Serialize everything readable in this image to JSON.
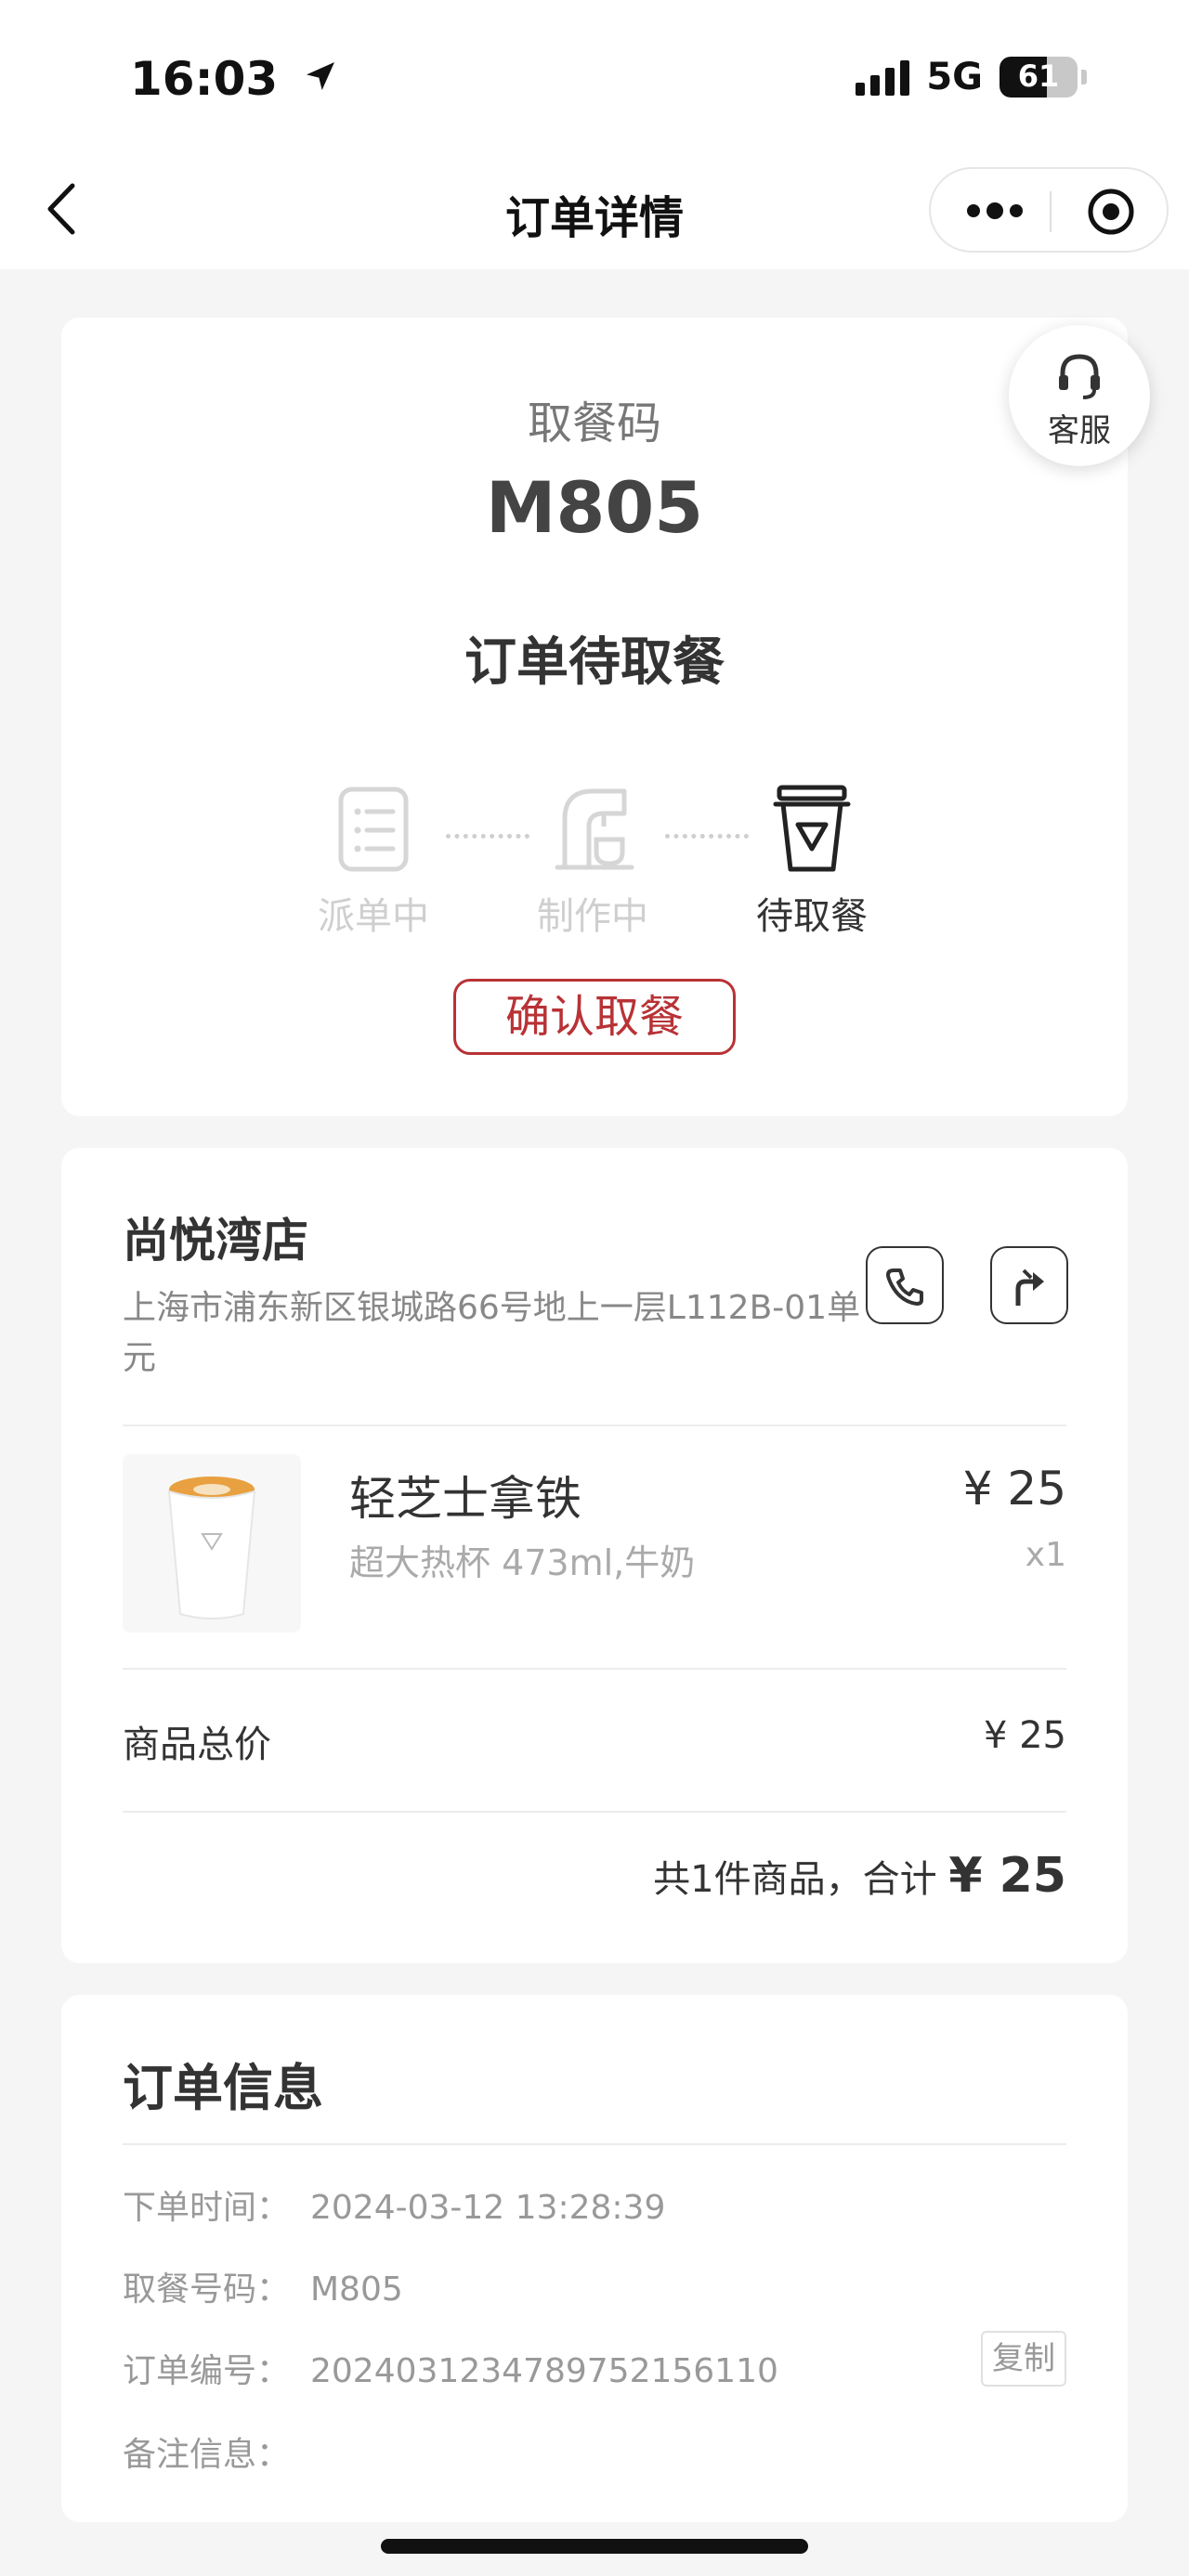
{
  "status_bar": {
    "time": "16:03",
    "network": "5G",
    "battery": "61",
    "battery_level": 0.61
  },
  "nav": {
    "title": "订单详情"
  },
  "pickup": {
    "label": "取餐码",
    "code": "M805",
    "status": "订单待取餐",
    "steps": [
      "派单中",
      "制作中",
      "待取餐"
    ],
    "active_step_index": 2,
    "confirm_label": "确认取餐"
  },
  "customer_service": {
    "label": "客服"
  },
  "store": {
    "name": "尚悦湾店",
    "address": "上海市浦东新区银城路66号地上一层L112B-01单元"
  },
  "product": {
    "name": "轻芝士拿铁",
    "spec": "超大热杯 473ml,牛奶",
    "price": "¥ 25",
    "qty": "x1"
  },
  "summary": {
    "subtotal_label": "商品总价",
    "subtotal_value": "¥ 25",
    "total_prefix": "共1件商品，合计",
    "total_value": "¥ 25"
  },
  "order_info": {
    "title": "订单信息",
    "rows": [
      {
        "key": "下单时间：",
        "value": "2024-03-12 13:28:39"
      },
      {
        "key": "取餐号码：",
        "value": "M805"
      },
      {
        "key": "订单编号：",
        "value": "20240312347897521561​10"
      },
      {
        "key": "备注信息：",
        "value": ""
      }
    ],
    "copy_label": "复制"
  }
}
